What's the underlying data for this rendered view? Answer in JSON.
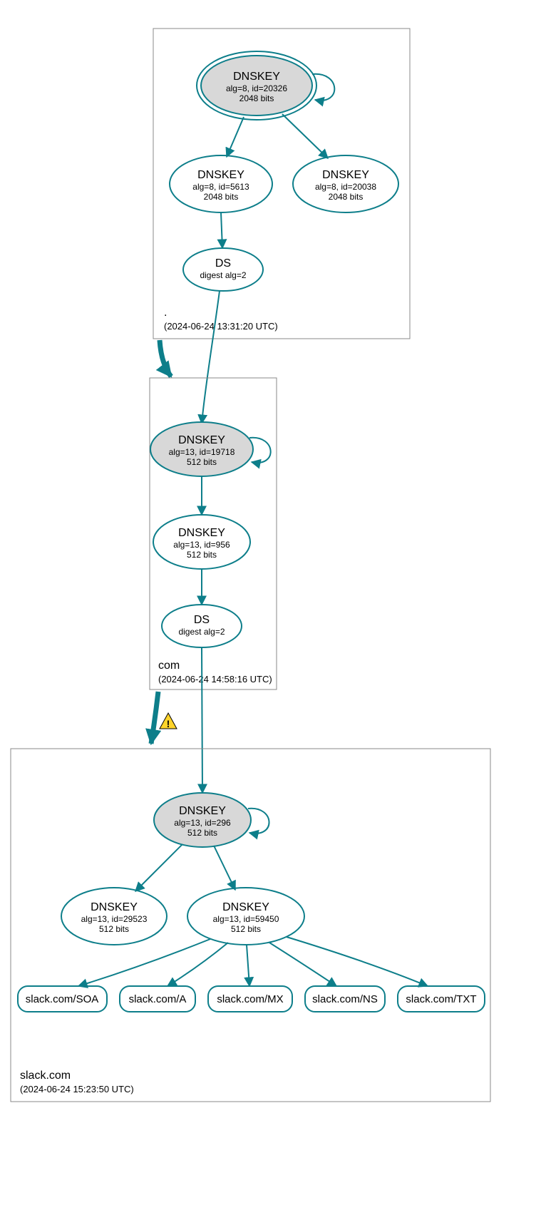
{
  "stroke_color": "#0d7e8a",
  "zones": {
    "root": {
      "name": ".",
      "timestamp": "(2024-06-24 13:31:20 UTC)",
      "ksk": {
        "title": "DNSKEY",
        "line2": "alg=8, id=20326",
        "line3": "2048 bits"
      },
      "zsk": {
        "title": "DNSKEY",
        "line2": "alg=8, id=5613",
        "line3": "2048 bits"
      },
      "extra": {
        "title": "DNSKEY",
        "line2": "alg=8, id=20038",
        "line3": "2048 bits"
      },
      "ds": {
        "title": "DS",
        "line2": "digest alg=2"
      }
    },
    "com": {
      "name": "com",
      "timestamp": "(2024-06-24 14:58:16 UTC)",
      "ksk": {
        "title": "DNSKEY",
        "line2": "alg=13, id=19718",
        "line3": "512 bits"
      },
      "zsk": {
        "title": "DNSKEY",
        "line2": "alg=13, id=956",
        "line3": "512 bits"
      },
      "ds": {
        "title": "DS",
        "line2": "digest alg=2"
      }
    },
    "slack": {
      "name": "slack.com",
      "timestamp": "(2024-06-24 15:23:50 UTC)",
      "ksk": {
        "title": "DNSKEY",
        "line2": "alg=13, id=296",
        "line3": "512 bits"
      },
      "extra": {
        "title": "DNSKEY",
        "line2": "alg=13, id=29523",
        "line3": "512 bits"
      },
      "zsk": {
        "title": "DNSKEY",
        "line2": "alg=13, id=59450",
        "line3": "512 bits"
      },
      "rr": {
        "soa": "slack.com/SOA",
        "a": "slack.com/A",
        "mx": "slack.com/MX",
        "ns": "slack.com/NS",
        "txt": "slack.com/TXT"
      }
    }
  },
  "warning_present": true
}
